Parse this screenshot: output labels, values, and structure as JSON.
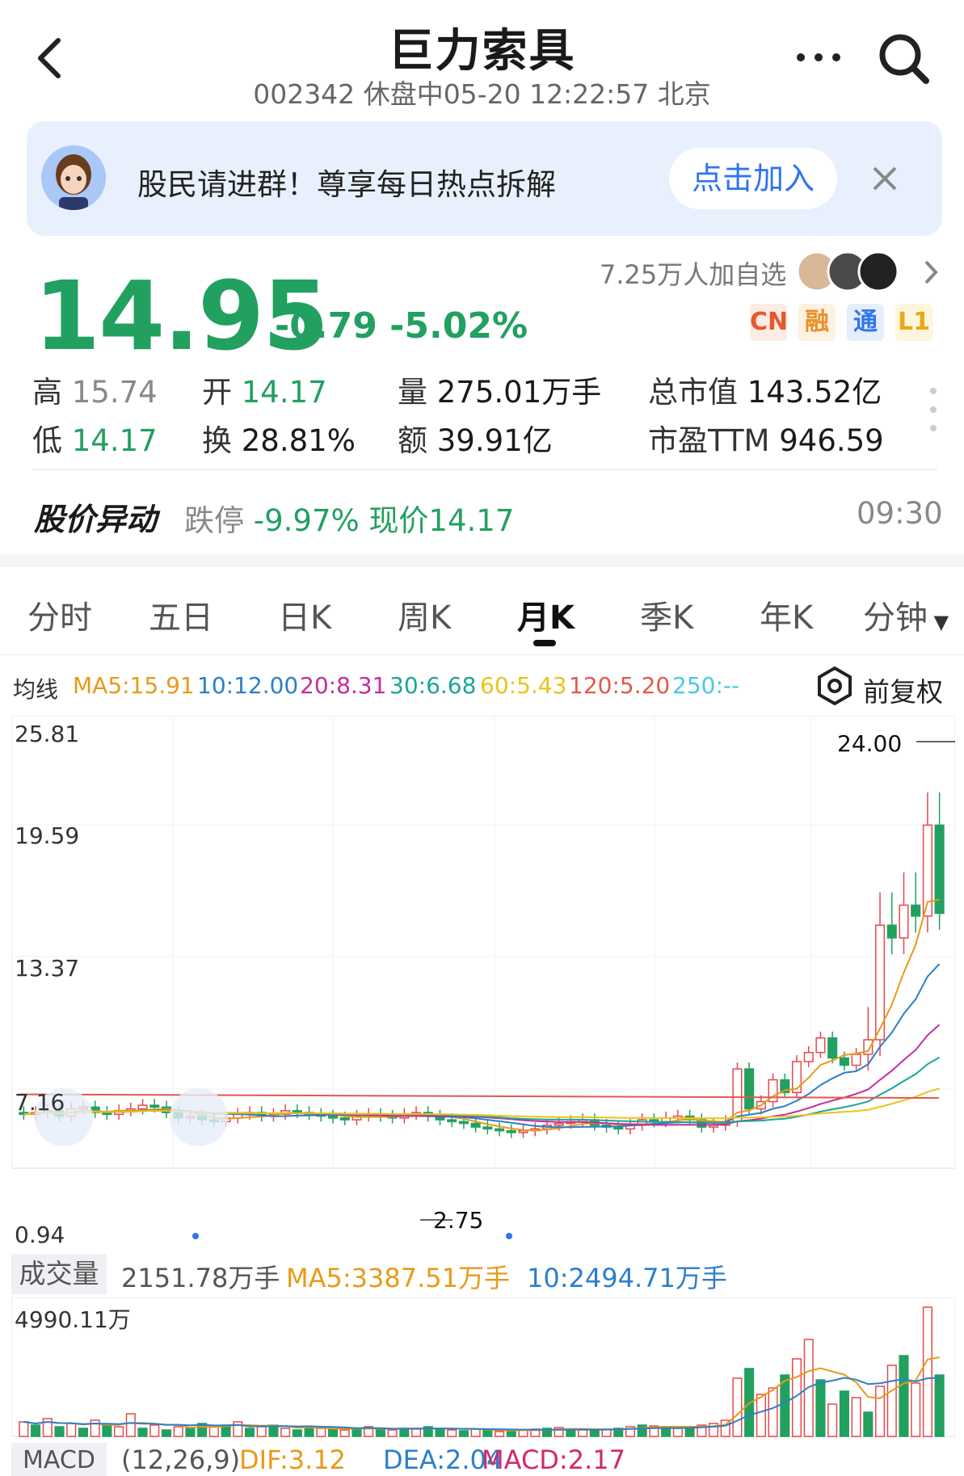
{
  "header": {
    "title": "巨力索具",
    "code": "002342",
    "status": "休盘中05-20 12:22:57 北京"
  },
  "banner": {
    "text": "股民请进群！尊享每日热点拆解",
    "button": "点击加入"
  },
  "quote": {
    "price": "14.95",
    "change": "-0.79",
    "change_pct": "-5.02%",
    "watchers": "7.25万人加自选",
    "tags": [
      "CN",
      "融",
      "通",
      "L1"
    ],
    "tag_colors": [
      "#e8582a",
      "#e8902a",
      "#2f74f0",
      "#e8a818"
    ]
  },
  "stats": {
    "high_k": "高",
    "high_v": "15.74",
    "open_k": "开",
    "open_v": "14.17",
    "vol_k": "量",
    "vol_v": "275.01万手",
    "mcap_k": "总市值",
    "mcap_v": "143.52亿",
    "low_k": "低",
    "low_v": "14.17",
    "turn_k": "换",
    "turn_v": "28.81%",
    "amt_k": "额",
    "amt_v": "39.91亿",
    "pe_k": "市盈TTM",
    "pe_v": "946.59"
  },
  "alert": {
    "label": "股价异动",
    "type": "跌停",
    "pct": "-9.97%",
    "price_text": "现价14.17",
    "time": "09:30"
  },
  "tabs": [
    "分时",
    "五日",
    "日K",
    "周K",
    "月K",
    "季K",
    "年K",
    "分钟"
  ],
  "ma_legend": {
    "label": "均线",
    "ma5": "MA5:15.91",
    "ma10": "10:12.00",
    "ma20": "20:8.31",
    "ma30": "30:6.68",
    "ma60": "60:5.43",
    "ma120": "120:5.20",
    "ma250": "250:--",
    "adjust": "前复权"
  },
  "chart_data": {
    "type": "candlestick",
    "y_ticks": [
      "25.81",
      "19.59",
      "13.37",
      "7.16",
      "0.94"
    ],
    "ylim": [
      0.94,
      25.81
    ],
    "max_label": "24.00",
    "min_label": "2.75",
    "colors": {
      "up": "#e8484a",
      "down": "#22a060",
      "ma5": "#e89a18",
      "ma10": "#2c7fc8",
      "ma20": "#c42d9c",
      "ma30": "#1ba59a",
      "ma60": "#e8c418",
      "ma120": "#e05a4a"
    }
  },
  "volume": {
    "label": "成交量",
    "value": "2151.78万手",
    "ma5": "MA5:3387.51万手",
    "ma10": "10:2494.71万手",
    "max": "4990.11万"
  },
  "macd": {
    "label": "MACD",
    "params": "(12,26,9)",
    "dif": "DIF:3.12",
    "dea": "DEA:2.04",
    "macd": "MACD:2.17"
  }
}
